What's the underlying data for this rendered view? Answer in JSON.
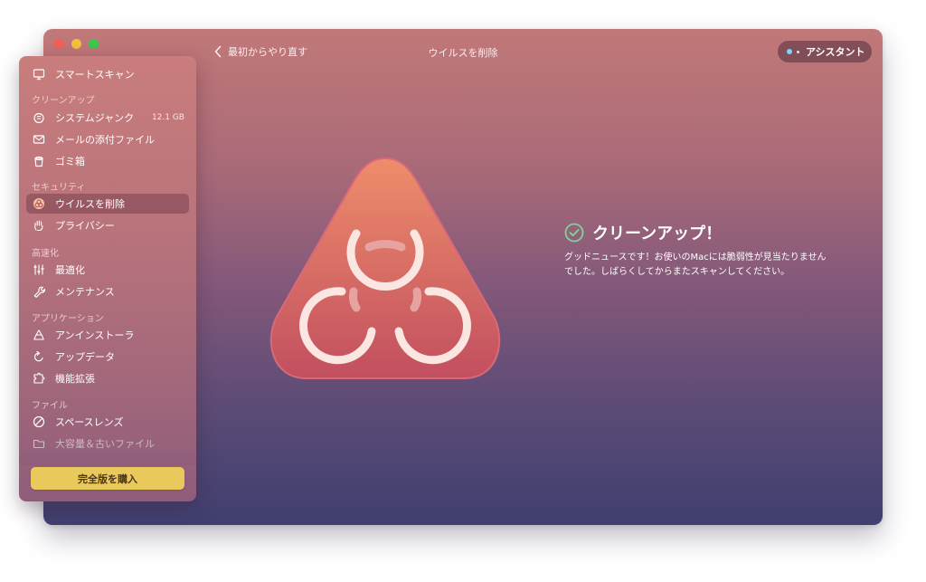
{
  "window": {
    "title": "ウイルスを削除",
    "back_label": "最初からやり直す",
    "assistant_label": "アシスタント"
  },
  "sidebar": {
    "smart_scan": "スマートスキャン",
    "sections": {
      "cleanup": "クリーンアップ",
      "security": "セキュリティ",
      "speed": "高速化",
      "applications": "アプリケーション",
      "files": "ファイル"
    },
    "items": {
      "system_junk": "システムジャンク",
      "system_junk_size": "12.1 GB",
      "mail_attachments": "メールの添付ファイル",
      "trash": "ゴミ箱",
      "malware_removal": "ウイルスを削除",
      "privacy": "プライバシー",
      "optimization": "最適化",
      "maintenance": "メンテナンス",
      "uninstaller": "アンインストーラ",
      "updater": "アップデータ",
      "extensions": "機能拡張",
      "space_lens": "スペースレンズ",
      "large_old_files": "大容量＆古いファイル"
    },
    "buy_label": "完全版を購入"
  },
  "result": {
    "title": "クリーンアップ！",
    "message": "グッドニュースです！お使いのMacには脆弱性が見当たりませんでした。しばらくしてからまたスキャンしてください。"
  },
  "colors": {
    "accent_buy": "#e9c95b",
    "hero_top": "#ec8a6a",
    "hero_bottom": "#c45260",
    "check_green": "#7fd39a"
  },
  "icons": {
    "smart_scan": "monitor-icon",
    "system_junk": "junk-icon",
    "mail_attachments": "envelope-icon",
    "trash": "trash-icon",
    "malware_removal": "biohazard-icon",
    "privacy": "hand-icon",
    "optimization": "sliders-icon",
    "maintenance": "wrench-icon",
    "uninstaller": "uninstaller-icon",
    "updater": "update-icon",
    "extensions": "extensions-icon",
    "space_lens": "lens-icon",
    "large_old_files": "folder-icon"
  }
}
